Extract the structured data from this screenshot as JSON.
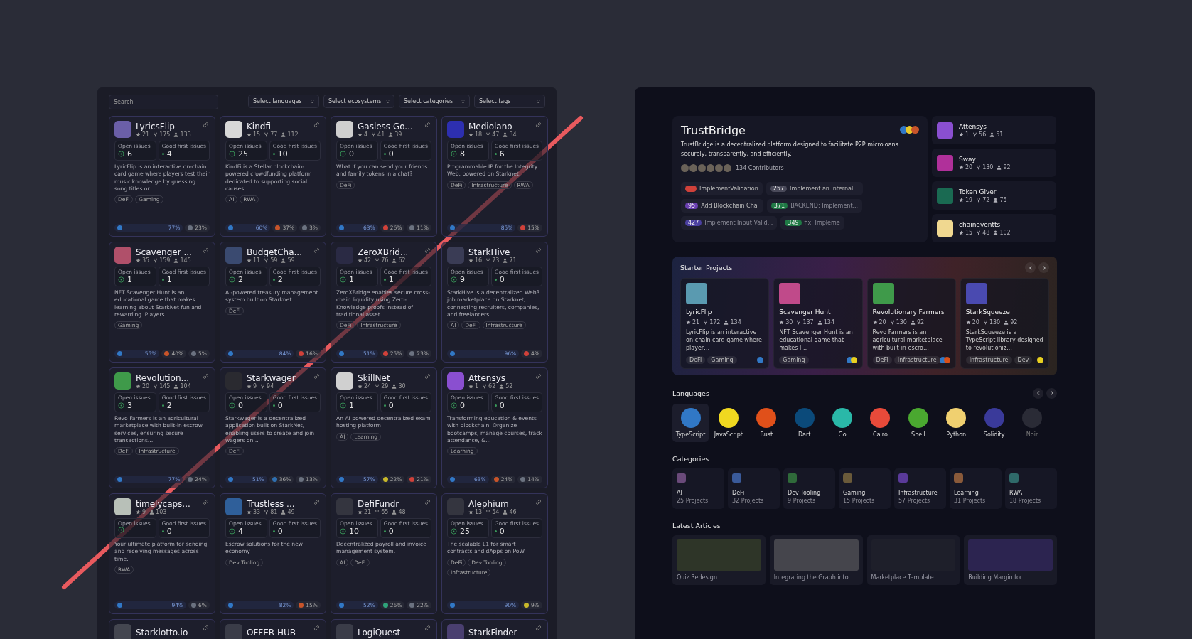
{
  "left_grid": {
    "search": {
      "placeholder": "Search"
    },
    "filters": [
      "Select languages",
      "Select ecosystems",
      "Select categories",
      "Select tags"
    ],
    "cards": [
      {
        "name": "LyricsFlip",
        "color": "#6b5fa8",
        "stars": "21",
        "forks": "175",
        "contributors": "133",
        "open_issues_label": "Open issues",
        "open_issues": "6",
        "good_first_issues_label": "Good first issues",
        "good_first_issues": "4",
        "description": "LyricFlip is an interactive on-chain card game where players test their music knowledge by guessing song titles or…",
        "tags": [
          "DeFi",
          "Gaming"
        ],
        "languages": [
          {
            "percent": "77%",
            "color": "#3178c6"
          },
          {
            "percent": "23%",
            "color": "#6b7280"
          }
        ]
      },
      {
        "name": "Kindfi",
        "color": "#d8d8d8",
        "stars": "15",
        "forks": "77",
        "contributors": "112",
        "open_issues_label": "Open issues",
        "open_issues": "25",
        "good_first_issues_label": "Good first issues",
        "good_first_issues": "10",
        "description": "KindFi is a Stellar blockchain-powered crowdfunding platform dedicated to supporting social causes",
        "tags": [
          "AI",
          "RWA"
        ],
        "languages": [
          {
            "percent": "60%",
            "color": "#3178c6"
          },
          {
            "percent": "37%",
            "color": "#c8542a"
          },
          {
            "percent": "3%",
            "color": "#6b7280"
          }
        ]
      },
      {
        "name": "Gasless Go...",
        "color": "#cfcfcf",
        "stars": "4",
        "forks": "41",
        "contributors": "39",
        "open_issues_label": "Open issues",
        "open_issues": "0",
        "good_first_issues_label": "Good first issues",
        "good_first_issues": "0",
        "description": "What if you can send your friends and family tokens in a chat?",
        "tags": [
          "DeFi"
        ],
        "languages": [
          {
            "percent": "63%",
            "color": "#3178c6"
          },
          {
            "percent": "26%",
            "color": "#d0413a"
          },
          {
            "percent": "11%",
            "color": "#6b7280"
          }
        ]
      },
      {
        "name": "Mediolano",
        "color": "#2d2fb0",
        "stars": "18",
        "forks": "47",
        "contributors": "34",
        "open_issues_label": "Open issues",
        "open_issues": "8",
        "good_first_issues_label": "Good first issues",
        "good_first_issues": "6",
        "description": "Programmable IP for the Integrity Web, powered on Starknet.",
        "tags": [
          "DeFi",
          "Infrastructure",
          "RWA"
        ],
        "languages": [
          {
            "percent": "85%",
            "color": "#3178c6"
          },
          {
            "percent": "15%",
            "color": "#d0413a"
          }
        ]
      },
      {
        "name": "Scavenger ...",
        "color": "#b0506a",
        "stars": "35",
        "forks": "159",
        "contributors": "145",
        "open_issues_label": "Open issues",
        "open_issues": "1",
        "good_first_issues_label": "Good first issues",
        "good_first_issues": "1",
        "description": "NFT Scavenger Hunt is an educational game that makes learning about StarkNet fun and rewarding. Players…",
        "tags": [
          "Gaming"
        ],
        "languages": [
          {
            "percent": "55%",
            "color": "#3178c6"
          },
          {
            "percent": "40%",
            "color": "#c8542a"
          },
          {
            "percent": "5%",
            "color": "#6b7280"
          }
        ]
      },
      {
        "name": "BudgetCha...",
        "color": "#3a4a70",
        "stars": "11",
        "forks": "59",
        "contributors": "59",
        "open_issues_label": "Open issues",
        "open_issues": "2",
        "good_first_issues_label": "Good first issues",
        "good_first_issues": "2",
        "description": "AI-powered treasury management system built on Starknet.",
        "tags": [
          "DeFi"
        ],
        "languages": [
          {
            "percent": "84%",
            "color": "#3178c6"
          },
          {
            "percent": "16%",
            "color": "#d0413a"
          }
        ]
      },
      {
        "name": "ZeroXBrid...",
        "color": "#2a2a44",
        "stars": "42",
        "forks": "76",
        "contributors": "62",
        "open_issues_label": "Open issues",
        "open_issues": "1",
        "good_first_issues_label": "Good first issues",
        "good_first_issues": "1",
        "description": "ZeroXBridge enables secure cross-chain liquidity using Zero-Knowledge proofs instead of traditional asset…",
        "tags": [
          "DeFi",
          "Infrastructure"
        ],
        "languages": [
          {
            "percent": "51%",
            "color": "#3178c6"
          },
          {
            "percent": "25%",
            "color": "#d0413a"
          },
          {
            "percent": "23%",
            "color": "#6b7280"
          }
        ]
      },
      {
        "name": "StarkHive",
        "color": "#3a3c55",
        "stars": "16",
        "forks": "73",
        "contributors": "71",
        "open_issues_label": "Open issues",
        "open_issues": "9",
        "good_first_issues_label": "Good first issues",
        "good_first_issues": "0",
        "description": "StarkHive is a decentralized Web3 job marketplace on Starknet, connecting recruiters, companies, and freelancers…",
        "tags": [
          "AI",
          "DeFi",
          "Infrastructure"
        ],
        "languages": [
          {
            "percent": "96%",
            "color": "#3178c6"
          },
          {
            "percent": "4%",
            "color": "#d0413a"
          }
        ]
      },
      {
        "name": "Revolution...",
        "color": "#3f9a4a",
        "stars": "20",
        "forks": "145",
        "contributors": "104",
        "open_issues_label": "Open issues",
        "open_issues": "3",
        "good_first_issues_label": "Good first issues",
        "good_first_issues": "2",
        "description": "Revo Farmers is an agricultural marketplace with built-in escrow services, ensuring secure transactions…",
        "tags": [
          "DeFi",
          "Infrastructure"
        ],
        "languages": [
          {
            "percent": "77%",
            "color": "#3178c6"
          },
          {
            "percent": "24%",
            "color": "#6b7280"
          }
        ]
      },
      {
        "name": "Starkwager",
        "color": "#2a2a30",
        "stars": "9",
        "forks": "94",
        "open_issues_label": "Open issues",
        "open_issues": "0",
        "good_first_issues_label": "Good first issues",
        "good_first_issues": "0",
        "description": "Starkwager is a decentralized application built on StarkNet, enabling users to create and join wagers on…",
        "tags": [
          "DeFi"
        ],
        "languages": [
          {
            "percent": "51%",
            "color": "#3178c6"
          },
          {
            "percent": "36%",
            "color": "#2f6fb0"
          },
          {
            "percent": "13%",
            "color": "#6b7280"
          }
        ]
      },
      {
        "name": "SkillNet",
        "color": "#d0d0d0",
        "stars": "24",
        "forks": "29",
        "contributors": "30",
        "open_issues_label": "Open issues",
        "open_issues": "1",
        "good_first_issues_label": "Good first issues",
        "good_first_issues": "0",
        "description": "An AI powered decentralized exam hosting platform",
        "tags": [
          "AI",
          "Learning"
        ],
        "languages": [
          {
            "percent": "57%",
            "color": "#3178c6"
          },
          {
            "percent": "22%",
            "color": "#c8b82a"
          },
          {
            "percent": "21%",
            "color": "#d0413a"
          }
        ]
      },
      {
        "name": "Attensys",
        "color": "#8a4fd0",
        "stars": "1",
        "forks": "62",
        "contributors": "52",
        "open_issues_label": "Open issues",
        "open_issues": "0",
        "good_first_issues_label": "Good first issues",
        "good_first_issues": "0",
        "description": "Transforming education & events with blockchain. Organize bootcamps, manage courses, track attendance, &…",
        "tags": [
          "Learning"
        ],
        "languages": [
          {
            "percent": "63%",
            "color": "#3178c6"
          },
          {
            "percent": "24%",
            "color": "#c8542a"
          },
          {
            "percent": "14%",
            "color": "#6b7280"
          }
        ]
      },
      {
        "name": "timelycaps...",
        "color": "#b8c0b8",
        "stars": "9",
        "contributors": "103",
        "open_issues_label": "Open issues",
        "good_first_issues_label": "Good first issues",
        "good_first_issues": "0",
        "description": "Your ultimate platform for sending and receiving messages across time.",
        "tags": [
          "RWA"
        ],
        "languages": [
          {
            "percent": "94%",
            "color": "#3178c6"
          },
          {
            "percent": "6%",
            "color": "#6b7280"
          }
        ]
      },
      {
        "name": "Trustless ...",
        "color": "#2f5f9a",
        "stars": "33",
        "forks": "81",
        "contributors": "49",
        "open_issues_label": "Open issues",
        "open_issues": "4",
        "good_first_issues_label": "Good first issues",
        "good_first_issues": "0",
        "description": "Escrow solutions for the new economy",
        "tags": [
          "Dev Tooling"
        ],
        "languages": [
          {
            "percent": "82%",
            "color": "#3178c6"
          },
          {
            "percent": "15%",
            "color": "#c8542a"
          }
        ]
      },
      {
        "name": "DefiFundr",
        "color": "#34353f",
        "stars": "21",
        "forks": "65",
        "contributors": "48",
        "open_issues_label": "Open issues",
        "open_issues": "10",
        "good_first_issues_label": "Good first issues",
        "good_first_issues": "0",
        "description": "Decentralized payroll and invoice management system.",
        "tags": [
          "AI",
          "DeFi"
        ],
        "languages": [
          {
            "percent": "52%",
            "color": "#3178c6"
          },
          {
            "percent": "26%",
            "color": "#2fa37a"
          },
          {
            "percent": "22%",
            "color": "#6b7280"
          }
        ]
      },
      {
        "name": "Alephium",
        "color": "#34353f",
        "stars": "13",
        "forks": "54",
        "contributors": "46",
        "open_issues_label": "Open issues",
        "open_issues": "25",
        "good_first_issues_label": "Good first issues",
        "good_first_issues": "0",
        "description": "The scalable L1 for smart contracts and dApps on PoW",
        "tags": [
          "DeFi",
          "Dev Tooling",
          "Infrastructure"
        ],
        "languages": [
          {
            "percent": "90%",
            "color": "#3178c6"
          },
          {
            "percent": "9%",
            "color": "#c8b82a"
          }
        ]
      },
      {
        "name": "Starklotto.io",
        "color": "#444650"
      },
      {
        "name": "OFFER-HUB",
        "color": "#3a3c48"
      },
      {
        "name": "LogiQuest",
        "color": "#3a3c48"
      },
      {
        "name": "StarkFinder",
        "color": "#4a3f70"
      }
    ]
  },
  "featured": {
    "title": "TrustBridge",
    "language_dots": [
      {
        "color": "#3178c6"
      },
      {
        "color": "#e8c82a"
      },
      {
        "color": "#c8542a"
      }
    ],
    "description": "TrustBridge is a decentralized platform designed to facilitate P2P microloans securely, transparently, and efficiently.",
    "contributors": "134 Contributors",
    "issues": [
      {
        "title": "ImplementValidation",
        "color": "#d0413a"
      },
      {
        "number": "257",
        "title": "Implement an internal...",
        "color": "#4a4a5a"
      },
      {
        "number": "95",
        "title": "Add Blockchain Chal",
        "color": "#6a3fb0"
      },
      {
        "number": "371",
        "title": "BACKEND: Implement...",
        "color": "#1f7a45"
      },
      {
        "number": "427",
        "title": "Implement Input Valid...",
        "color": "#4a3fa0"
      },
      {
        "number": "349",
        "title": "fix: Impleme",
        "color": "#1f7a45"
      }
    ]
  },
  "side_projects": [
    {
      "name": "Attensys",
      "color": "#8a4fd0",
      "stars": "1",
      "forks": "56",
      "contributors": "51"
    },
    {
      "name": "Sway",
      "color": "#b0309a",
      "stars": "20",
      "forks": "130",
      "contributors": "92"
    },
    {
      "name": "Token Giver",
      "color": "#1a6a52",
      "stars": "19",
      "forks": "72",
      "contributors": "75"
    },
    {
      "name": "chaineventts",
      "color": "#f0d890",
      "stars": "15",
      "forks": "48",
      "contributors": "102"
    }
  ],
  "starter_projects": {
    "title": "Starter Projects",
    "items": [
      {
        "name": "LyricFlip",
        "color": "#5a9ab0",
        "stars": "21",
        "forks": "172",
        "contributors": "134",
        "description": "LyricFlip is an interactive on-chain card game where player…",
        "tags": [
          "DeFi",
          "Gaming"
        ],
        "languages": [
          {
            "color": "#3178c6"
          }
        ]
      },
      {
        "name": "Scavenger Hunt",
        "color": "#c04a8a",
        "stars": "30",
        "forks": "137",
        "contributors": "134",
        "description": "NFT Scavenger Hunt is an educational game that makes l…",
        "tags": [
          "Gaming"
        ],
        "languages": [
          {
            "color": "#3178c6"
          },
          {
            "color": "#e8d020"
          }
        ]
      },
      {
        "name": "Revolutionary Farmers",
        "color": "#3f9a4a",
        "stars": "20",
        "forks": "130",
        "contributors": "92",
        "description": "Revo Farmers is an agricultural marketplace with built-in escro…",
        "tags": [
          "DeFi",
          "Infrastructure"
        ],
        "languages": [
          {
            "color": "#3178c6"
          },
          {
            "color": "#d8501a"
          }
        ]
      },
      {
        "name": "StarkSqueeze",
        "color": "#4a4ab0",
        "stars": "20",
        "forks": "130",
        "contributors": "92",
        "description": "StarkSqueeze is a TypeScript library designed to revolutioniz…",
        "tags": [
          "Infrastructure",
          "Dev"
        ],
        "languages": [
          {
            "color": "#e8d020"
          }
        ]
      }
    ]
  },
  "languages": {
    "title": "Languages",
    "items": [
      {
        "name": "TypeScript",
        "color": "#3178c6",
        "selected": true
      },
      {
        "name": "JavaScript",
        "color": "#f0d820",
        "selected": false
      },
      {
        "name": "Rust",
        "color": "#e0501a",
        "selected": false
      },
      {
        "name": "Dart",
        "color": "#0b4a7a",
        "selected": false
      },
      {
        "name": "Go",
        "color": "#2ab8a8",
        "selected": false
      },
      {
        "name": "Cairo",
        "color": "#e84a3a",
        "selected": false
      },
      {
        "name": "Shell",
        "color": "#4aa830",
        "selected": false
      },
      {
        "name": "Python",
        "color": "#f0d070",
        "selected": false
      },
      {
        "name": "Solidity",
        "color": "#3a3a9a",
        "selected": false
      },
      {
        "name": "Noir",
        "color": "#2a2b36",
        "selected": false
      }
    ]
  },
  "categories": {
    "title": "Categories",
    "items": [
      {
        "name": "AI",
        "count": "25 Projects",
        "color": "#6a4a7a"
      },
      {
        "name": "DeFi",
        "count": "32 Projects",
        "color": "#3a5a9a"
      },
      {
        "name": "Dev Tooling",
        "count": "9 Projects",
        "color": "#2f6a3a"
      },
      {
        "name": "Gaming",
        "count": "15 Projects",
        "color": "#6a5a3a"
      },
      {
        "name": "Infrastructure",
        "count": "57 Projects",
        "color": "#5a3a9a"
      },
      {
        "name": "Learning",
        "count": "31 Projects",
        "color": "#8a5a3a"
      },
      {
        "name": "RWA",
        "count": "18 Projects",
        "color": "#2f6a6a"
      }
    ]
  },
  "articles": {
    "title": "Latest Articles",
    "items": [
      {
        "title": "Quiz Redesign",
        "color": "#2e3528"
      },
      {
        "title": "Integrating the Graph into",
        "color": "#45454c"
      },
      {
        "title": "Marketplace Template",
        "color": "#1e1f2a"
      },
      {
        "title": "Building Margin for",
        "color": "#2c2450"
      }
    ]
  }
}
